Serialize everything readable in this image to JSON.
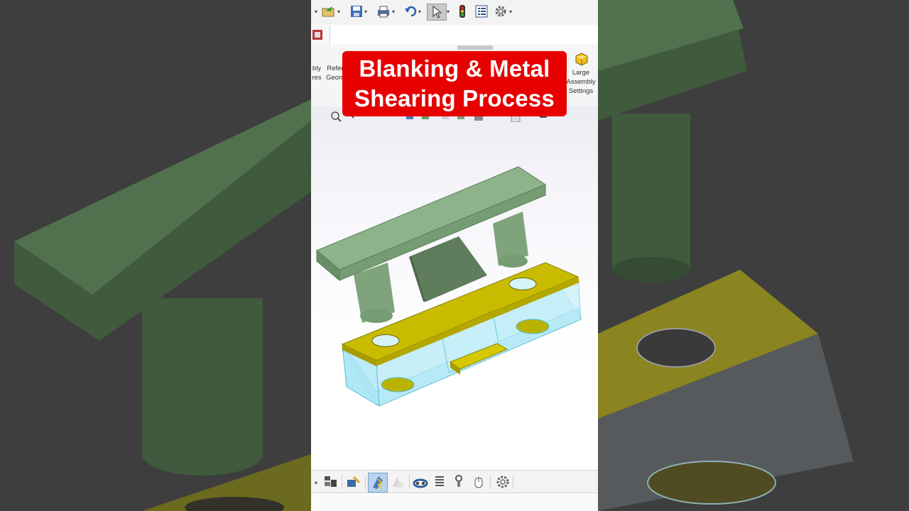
{
  "banner": {
    "line1": "Blanking & Metal",
    "line2": "Shearing Process"
  },
  "ribbon": {
    "assembly_features_partial": "bly\nres",
    "reference_geometry_partial": "Refer\nGeom",
    "large_assembly_settings": "Large\nAssembly\nSettings"
  },
  "icons": {
    "top_toolbar": [
      "caret-icon",
      "open-folder-icon",
      "save-icon",
      "print-icon",
      "undo-icon",
      "select-pointer-icon",
      "rebuild-traffic-light-icon",
      "file-properties-icon",
      "options-gear-icon"
    ],
    "bottom_toolbar": [
      "caret-icon",
      "exploded-view-icon",
      "instant3d-icon",
      "smart-fastener-icon",
      "ghost-fastener-icon",
      "belt-chain-icon",
      "spring-icon",
      "bolt-icon",
      "mouse-icon",
      "settings-gear-icon"
    ]
  },
  "colors": {
    "banner_bg": "#e60000",
    "punch": "#8db38a",
    "die_plate": "#c9bc00",
    "die_body": "#9fe3f2"
  }
}
